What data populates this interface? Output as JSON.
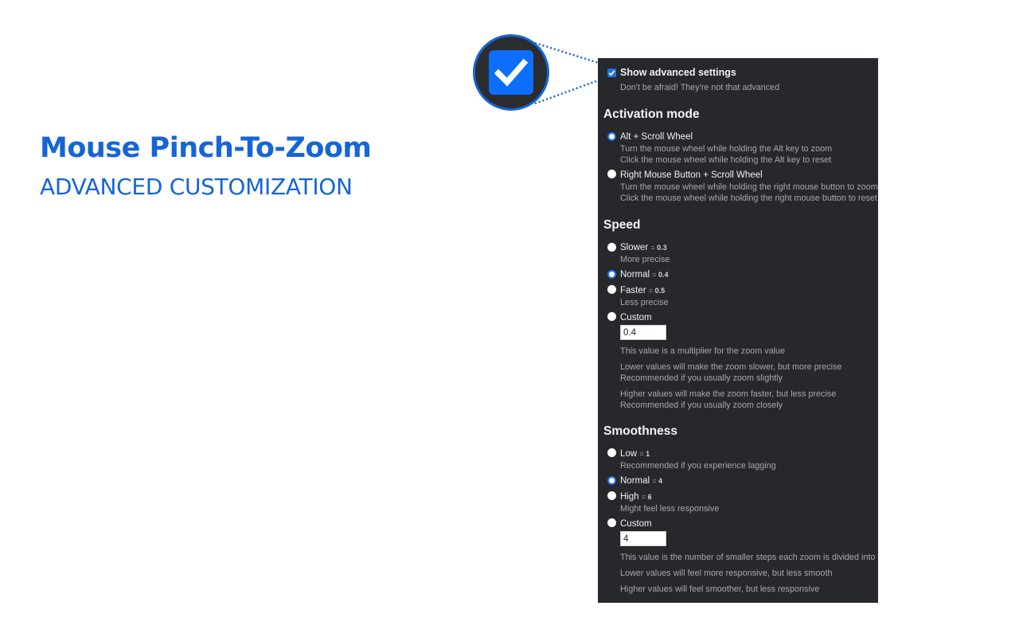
{
  "promo": {
    "title": "Mouse Pinch-To-Zoom",
    "subtitle": "ADVANCED CUSTOMIZATION"
  },
  "colors": {
    "accent": "#1565d8",
    "panel_bg": "#27282c",
    "radio_selected": "#1a73e8"
  },
  "advanced": {
    "label": "Show advanced settings",
    "checked": true,
    "description": "Don't be afraid! They're not that advanced"
  },
  "activation": {
    "heading": "Activation mode",
    "options": [
      {
        "label": "Alt + Scroll Wheel",
        "selected": true,
        "desc1": "Turn the mouse wheel while holding the Alt key to zoom",
        "desc2": "Click the mouse wheel while holding the Alt key to reset"
      },
      {
        "label": "Right Mouse Button + Scroll Wheel",
        "selected": false,
        "desc1": "Turn the mouse wheel while holding the right mouse button to zoom",
        "desc2": "Click the mouse wheel while holding the right mouse button to reset"
      }
    ]
  },
  "speed": {
    "heading": "Speed",
    "options": [
      {
        "label": "Slower",
        "eq": "=",
        "value": "0.3",
        "selected": false,
        "desc": "More precise"
      },
      {
        "label": "Normal",
        "eq": "=",
        "value": "0.4",
        "selected": true,
        "desc": ""
      },
      {
        "label": "Faster",
        "eq": "=",
        "value": "0.5",
        "selected": false,
        "desc": "Less precise"
      },
      {
        "label": "Custom",
        "selected": false
      }
    ],
    "custom_value": "0.4",
    "notes": [
      "This value is a multiplier for the zoom value",
      "Lower values will make the zoom slower, but more precise",
      "Recommended if you usually zoom slightly",
      "Higher values will make the zoom faster, but less precise",
      "Recommended if you usually zoom closely"
    ]
  },
  "smoothness": {
    "heading": "Smoothness",
    "options": [
      {
        "label": "Low",
        "eq": "=",
        "value": "1",
        "selected": false,
        "desc": "Recommended if you experience lagging"
      },
      {
        "label": "Normal",
        "eq": "=",
        "value": "4",
        "selected": true,
        "desc": ""
      },
      {
        "label": "High",
        "eq": "=",
        "value": "6",
        "selected": false,
        "desc": "Might feel less responsive"
      },
      {
        "label": "Custom",
        "selected": false
      }
    ],
    "custom_value": "4",
    "notes": [
      "This value is the number of smaller steps each zoom is divided into",
      "Lower values will feel more responsive, but less smooth",
      "Higher values will feel smoother, but less responsive"
    ]
  }
}
